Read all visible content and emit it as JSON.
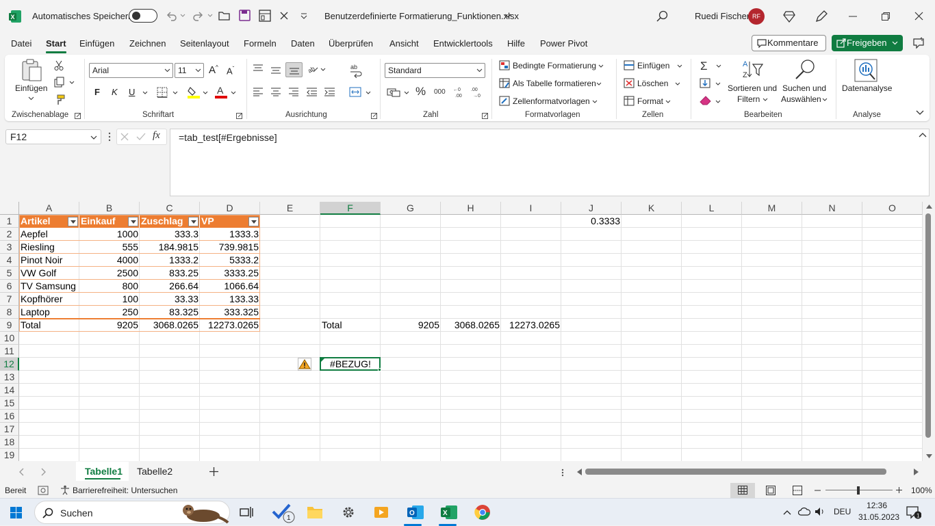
{
  "titlebar": {
    "autosave_label": "Automatisches Speichern",
    "filename": "Benutzerdefinierte Formatierung_Funktionen.xlsx",
    "user_name": "Ruedi Fischer",
    "user_initials": "RF"
  },
  "menu": {
    "items": [
      "Datei",
      "Start",
      "Einfügen",
      "Zeichnen",
      "Seitenlayout",
      "Formeln",
      "Daten",
      "Überprüfen",
      "Ansicht",
      "Entwicklertools",
      "Hilfe",
      "Power Pivot"
    ],
    "active": "Start",
    "kommentare": "Kommentare",
    "freigeben": "Freigeben"
  },
  "ribbon": {
    "clipboard": {
      "paste": "Einfügen",
      "label": "Zwischenablage"
    },
    "font": {
      "name": "Arial",
      "size": "11",
      "label": "Schriftart",
      "bold": "F",
      "italic": "K",
      "underline": "U"
    },
    "alignment": {
      "label": "Ausrichtung"
    },
    "number": {
      "format": "Standard",
      "label": "Zahl"
    },
    "styles": {
      "conditional": "Bedingte Formatierung",
      "as_table": "Als Tabelle formatieren",
      "cell_styles": "Zellenformatvorlagen",
      "label": "Formatvorlagen"
    },
    "cells": {
      "insert": "Einfügen",
      "delete": "Löschen",
      "format": "Format",
      "label": "Zellen"
    },
    "editing": {
      "sort1": "Sortieren und",
      "sort2": "Filtern",
      "find1": "Suchen und",
      "find2": "Auswählen",
      "label": "Bearbeiten"
    },
    "analysis": {
      "data_analysis": "Datenanalyse",
      "label": "Analyse"
    }
  },
  "formula_bar": {
    "name_box": "F12",
    "formula": "=tab_test[#Ergebnisse]"
  },
  "grid": {
    "columns": [
      "A",
      "B",
      "C",
      "D",
      "E",
      "F",
      "G",
      "H",
      "I",
      "J",
      "K",
      "L",
      "M",
      "N",
      "O"
    ],
    "rows": [
      "1",
      "2",
      "3",
      "4",
      "5",
      "6",
      "7",
      "8",
      "9",
      "10",
      "11",
      "12",
      "13",
      "14",
      "15",
      "16",
      "17",
      "18",
      "19"
    ],
    "selected_cell": "F12",
    "table_headers": [
      "Artikel",
      "Einkauf",
      "Zuschlag",
      "VP"
    ],
    "table_rows": [
      [
        "Aepfel",
        "1000",
        "333.3",
        "1333.3"
      ],
      [
        "Riesling",
        "555",
        "184.9815",
        "739.9815"
      ],
      [
        "Pinot Noir",
        "4000",
        "1333.2",
        "5333.2"
      ],
      [
        "VW Golf",
        "2500",
        "833.25",
        "3333.25"
      ],
      [
        "TV Samsung",
        "800",
        "266.64",
        "1066.64"
      ],
      [
        "Kopfhörer",
        "100",
        "33.33",
        "133.33"
      ],
      [
        "Laptop",
        "250",
        "83.325",
        "333.325"
      ]
    ],
    "total_row": [
      "Total",
      "9205",
      "3068.0265",
      "12273.0265"
    ],
    "j1": "0.3333",
    "f9": "Total",
    "g9": "9205",
    "h9": "3068.0265",
    "i9": "12273.0265",
    "f12": "#BEZUG!"
  },
  "sheets": {
    "tabs": [
      "Tabelle1",
      "Tabelle2"
    ],
    "active": "Tabelle1"
  },
  "status": {
    "ready": "Bereit",
    "accessibility": "Barrierefreiheit: Untersuchen",
    "zoom": "100%"
  },
  "taskbar": {
    "search": "Suchen",
    "language": "DEU",
    "time": "12:36",
    "date": "31.05.2023",
    "badge": "1"
  },
  "colors": {
    "accent": "#107c41",
    "table_header": "#ed7d31",
    "table_border": "#f4b183",
    "error_icon": "#f5a623"
  }
}
